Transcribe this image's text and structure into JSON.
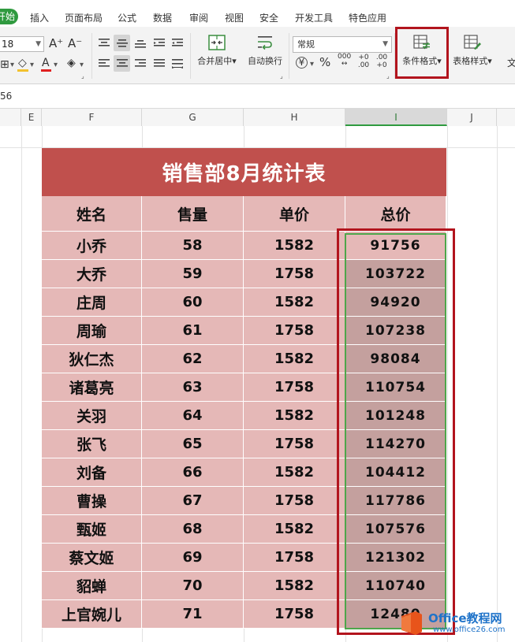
{
  "ribbon_tabs": {
    "start": "开始",
    "items": [
      "插入",
      "页面布局",
      "公式",
      "数据",
      "审阅",
      "视图",
      "安全",
      "开发工具",
      "特色应用"
    ]
  },
  "ribbon": {
    "font_size": "18",
    "grow_font": "A⁺",
    "shrink_font": "A⁻",
    "merge_center": "合并居中",
    "wrap_text": "自动换行",
    "number_format": "常规",
    "currency": "¥",
    "percent": "%",
    "thousands": "000",
    "inc_decimal": "+0 .00",
    "dec_decimal": ".00 +0",
    "conditional_format": "条件格式",
    "table_style": "表格样式",
    "text_partial": "文"
  },
  "formula_bar": {
    "value": "56"
  },
  "columns": {
    "headers": [
      "E",
      "F",
      "G",
      "H",
      "I",
      "J"
    ],
    "selected": "I"
  },
  "table": {
    "title": "销售部8月统计表",
    "headers": [
      "姓名",
      "售量",
      "单价",
      "总价"
    ],
    "rows": [
      [
        "小乔",
        "58",
        "1582",
        "91756"
      ],
      [
        "大乔",
        "59",
        "1758",
        "103722"
      ],
      [
        "庄周",
        "60",
        "1582",
        "94920"
      ],
      [
        "周瑜",
        "61",
        "1758",
        "107238"
      ],
      [
        "狄仁杰",
        "62",
        "1582",
        "98084"
      ],
      [
        "诸葛亮",
        "63",
        "1758",
        "110754"
      ],
      [
        "关羽",
        "64",
        "1582",
        "101248"
      ],
      [
        "张飞",
        "65",
        "1758",
        "114270"
      ],
      [
        "刘备",
        "66",
        "1582",
        "104412"
      ],
      [
        "曹操",
        "67",
        "1758",
        "117786"
      ],
      [
        "甄姬",
        "68",
        "1582",
        "107576"
      ],
      [
        "蔡文姬",
        "69",
        "1758",
        "121302"
      ],
      [
        "貂蝉",
        "70",
        "1582",
        "110740"
      ],
      [
        "上官婉儿",
        "71",
        "1758",
        "12480"
      ]
    ]
  },
  "colors": {
    "title_bg": "#c0504d",
    "cell_bg": "#e5b8b7",
    "highlight_bg": "#c4a09e",
    "frame_red": "#b2141d",
    "frame_green": "#4ea64b",
    "start_tab": "#2f9a3f"
  },
  "watermark": {
    "text1": "Office教程网",
    "text2": "www.office26.com"
  }
}
